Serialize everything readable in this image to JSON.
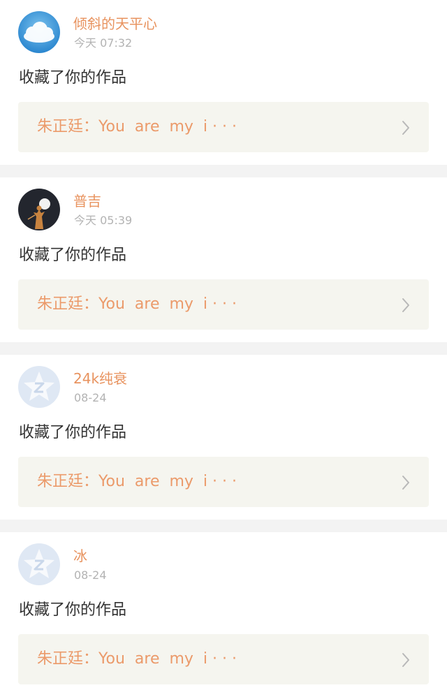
{
  "notifications": [
    {
      "avatar_icon": "cloud-avatar-icon",
      "user": "倾斜的天平心",
      "time": "今天 07:32",
      "action": "收藏了你的作品",
      "work_title": "朱正廷：You  are  my  i · · ·"
    },
    {
      "avatar_icon": "night-figure-avatar-icon",
      "user": "普吉",
      "time": "今天 05:39",
      "action": "收藏了你的作品",
      "work_title": "朱正廷：You  are  my  i · · ·"
    },
    {
      "avatar_icon": "default-star-avatar-icon",
      "user": "24k纯衰",
      "time": "08-24",
      "action": "收藏了你的作品",
      "work_title": "朱正廷：You  are  my  i · · ·"
    },
    {
      "avatar_icon": "default-star-avatar-icon",
      "user": "冰",
      "time": "08-24",
      "action": "收藏了你的作品",
      "work_title": "朱正廷：You  are  my  i · · ·"
    }
  ],
  "colors": {
    "username": "#e8935f",
    "work_title": "#eb9a6a",
    "time": "#b3b3b3",
    "work_box_bg": "#f5f5ef",
    "separator": "#f3f3f3"
  },
  "icons": {
    "chevron": "chevron-right-icon"
  }
}
